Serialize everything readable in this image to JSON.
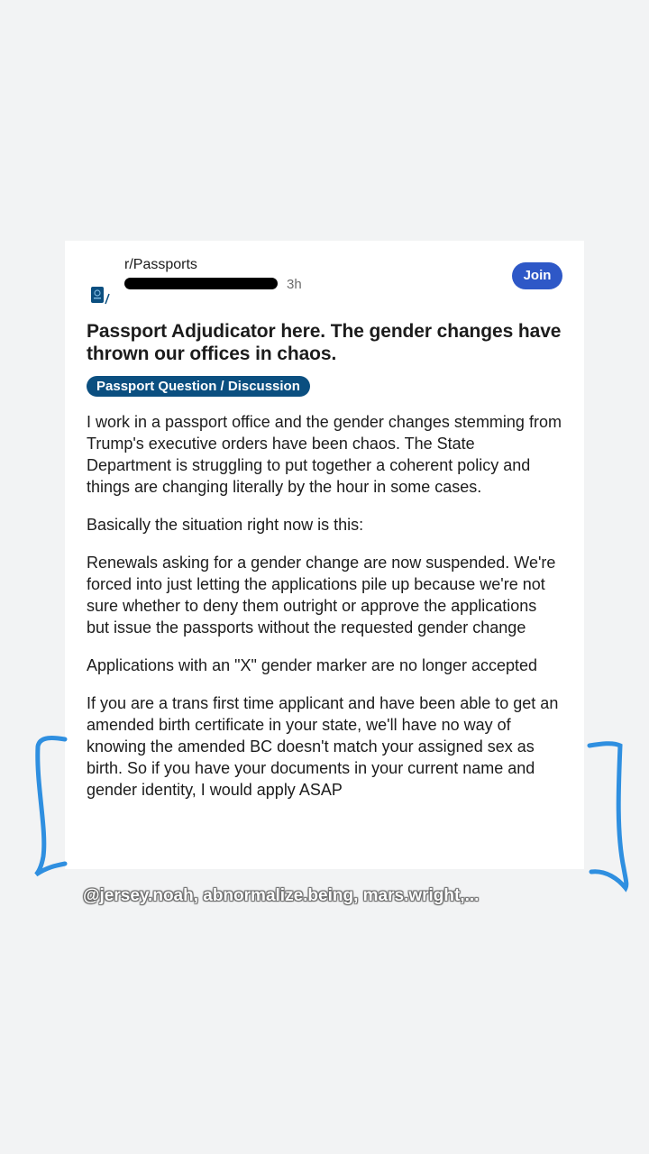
{
  "post": {
    "subreddit": "r/Passports",
    "time": "3h",
    "join_label": "Join",
    "title": "Passport Adjudicator here. The gender changes have thrown our offices in chaos.",
    "flair": "Passport Question / Discussion",
    "paragraphs": [
      "I work in a passport office and the gender changes stemming from Trump's executive orders have been chaos. The State Department is struggling to put together a coherent policy and things are changing literally by the hour in some cases.",
      "Basically the situation right now is this:",
      "Renewals asking for a gender change are now suspended. We're forced into just letting the applications pile up because we're not sure whether to deny them outright or approve the applications but issue the passports without the requested gender change",
      "Applications with an \"X\" gender marker are no longer accepted",
      "If you are a trans first time applicant and have been able to get an amended birth certificate in your state, we'll have no way of knowing the amended BC doesn't match your assigned sex as birth. So if you have your documents in your current name and gender identity, I would apply ASAP"
    ]
  },
  "overlay": {
    "tags": "@jersey.noah, abnormalize.being, mars.wright,..."
  },
  "colors": {
    "join": "#2e58c7",
    "flair": "#0b4f80",
    "bracket": "#2f8fe0"
  }
}
